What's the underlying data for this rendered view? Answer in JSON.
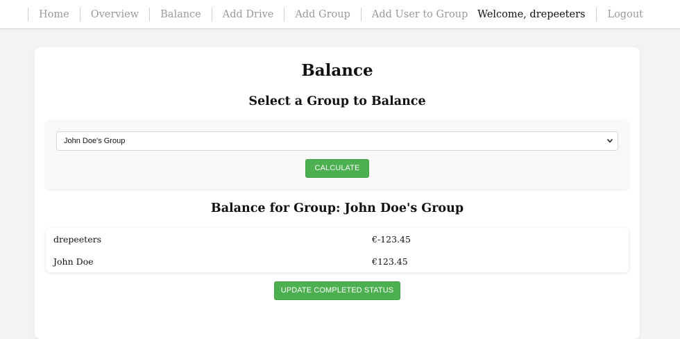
{
  "nav": {
    "links": [
      "Home",
      "Overview",
      "Balance",
      "Add Drive",
      "Add Group",
      "Add User to Group"
    ],
    "welcome": "Welcome, drepeeters",
    "logout": "Logout"
  },
  "main": {
    "title": "Balance",
    "subtitle": "Select a Group to Balance",
    "group_select": {
      "selected": "John Doe's Group"
    },
    "calculate_label": "CALCULATE",
    "result_heading": "Balance for Group: John Doe's Group",
    "balances": [
      {
        "name": "drepeeters",
        "amount": "€-123.45"
      },
      {
        "name": "John Doe",
        "amount": "€123.45"
      }
    ],
    "update_label": "UPDATE COMPLETED STATUS"
  },
  "colors": {
    "accent": "#4caf50",
    "nav_link": "#9a9a9a",
    "background": "#f3f3f3"
  },
  "icons": [
    "chevron-down-icon"
  ]
}
